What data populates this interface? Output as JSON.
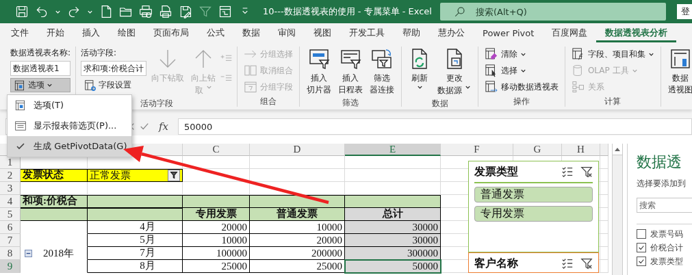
{
  "title_bar": {
    "title": "10---数据透视表的使用 - 专属菜单 - Excel",
    "search": {
      "placeholder": "搜索(Alt+Q)"
    },
    "account_button": "登"
  },
  "ribbon_tabs": [
    {
      "label": "文件",
      "selected": false
    },
    {
      "label": "开始",
      "selected": false
    },
    {
      "label": "插入",
      "selected": false
    },
    {
      "label": "绘图",
      "selected": false
    },
    {
      "label": "页面布局",
      "selected": false
    },
    {
      "label": "公式",
      "selected": false
    },
    {
      "label": "数据",
      "selected": false
    },
    {
      "label": "审阅",
      "selected": false
    },
    {
      "label": "视图",
      "selected": false
    },
    {
      "label": "开发工具",
      "selected": false
    },
    {
      "label": "帮助",
      "selected": false
    },
    {
      "label": "慧办公",
      "selected": false
    },
    {
      "label": "Power Pivot",
      "selected": false
    },
    {
      "label": "百度网盘",
      "selected": false
    },
    {
      "label": "数据透视表分析",
      "selected": true
    }
  ],
  "ribbon": {
    "groups": [
      {
        "columns": [
          {
            "kind": "fields",
            "items": [
              {
                "kind": "caption",
                "text": "数据透视表名称:"
              },
              {
                "kind": "input",
                "value": "数据透视表1"
              },
              {
                "kind": "button",
                "label": "选项",
                "dropdown": true,
                "pressed": true
              }
            ]
          }
        ]
      },
      {
        "label": "活动字段",
        "columns": [
          {
            "kind": "fields",
            "items": [
              {
                "kind": "caption",
                "text": "活动字段:"
              },
              {
                "kind": "input",
                "value": "求和项:价税合计"
              },
              {
                "kind": "button",
                "label": "字段设置",
                "dropdown": false,
                "pressed": false
              }
            ]
          },
          {
            "kind": "large",
            "lines": [
              "向下钻取"
            ],
            "disabled": true,
            "dropdown": false
          },
          {
            "kind": "large",
            "lines": [
              "向上钻",
              "取"
            ],
            "disabled": true,
            "dropdown": true
          },
          {
            "kind": "icons",
            "disabled": true
          }
        ]
      },
      {
        "label": "组合",
        "columns": [
          {
            "kind": "stack",
            "items": [
              {
                "label": "分组选择",
                "disabled": true,
                "dropdown": false
              },
              {
                "label": "取消组合",
                "disabled": true,
                "dropdown": false
              },
              {
                "label": "分组字段",
                "disabled": true,
                "dropdown": false
              }
            ]
          }
        ]
      },
      {
        "label": "筛选",
        "columns": [
          {
            "kind": "large",
            "lines": [
              "插入",
              "切片器"
            ],
            "disabled": false,
            "dropdown": false
          },
          {
            "kind": "large",
            "lines": [
              "插入",
              "日程表"
            ],
            "disabled": false,
            "dropdown": false
          },
          {
            "kind": "large",
            "lines": [
              "筛选",
              "器连接"
            ],
            "disabled": false,
            "dropdown": false
          }
        ]
      },
      {
        "label": "数据",
        "columns": [
          {
            "kind": "large",
            "lines": [
              "刷新"
            ],
            "disabled": false,
            "dropdown": true
          },
          {
            "kind": "large",
            "lines": [
              "更改",
              "数据源"
            ],
            "disabled": false,
            "dropdown": true
          }
        ]
      },
      {
        "label": "操作",
        "columns": [
          {
            "kind": "stack",
            "items": [
              {
                "label": "清除",
                "disabled": false,
                "dropdown": true
              },
              {
                "label": "选择",
                "disabled": false,
                "dropdown": true
              },
              {
                "label": "移动数据透视表",
                "disabled": false,
                "dropdown": false
              }
            ]
          }
        ]
      },
      {
        "label": "计算",
        "columns": [
          {
            "kind": "stack",
            "items": [
              {
                "label": "字段、项目和集",
                "disabled": false,
                "dropdown": true
              },
              {
                "label": "OLAP 工具",
                "disabled": true,
                "dropdown": true
              },
              {
                "label": "关系",
                "disabled": true,
                "dropdown": false
              }
            ]
          }
        ]
      },
      {
        "columns": [
          {
            "kind": "large",
            "lines": [
              "数据",
              "透视图"
            ],
            "disabled": false,
            "dropdown": false
          }
        ]
      }
    ]
  },
  "options_menu": {
    "items": [
      {
        "label": "选项(T)",
        "checked": false,
        "selected": false
      },
      {
        "label": "显示报表筛选页(P)...",
        "checked": false,
        "selected": false
      },
      {
        "label": "生成 GetPivotData(G)",
        "checked": true,
        "selected": true
      }
    ]
  },
  "formula_bar": {
    "insert_function": "fx",
    "value": "50000"
  },
  "sheet": {
    "columns": [
      {
        "label": "C",
        "selected": false
      },
      {
        "label": "D",
        "selected": false
      },
      {
        "label": "E",
        "selected": true
      },
      {
        "label": "F",
        "selected": false
      },
      {
        "label": "G",
        "selected": false
      },
      {
        "label": "H",
        "selected": false
      }
    ],
    "rows": [
      {
        "label": "1",
        "selected": false,
        "cells": [
          {
            "kind": "empty"
          },
          {
            "kind": "empty"
          },
          {
            "kind": "empty"
          },
          {
            "kind": "empty"
          },
          {
            "kind": "empty"
          },
          {
            "kind": "empty"
          },
          {
            "kind": "empty"
          },
          {
            "kind": "empty"
          }
        ]
      },
      {
        "label": "2",
        "selected": false,
        "cells": [
          {
            "kind": "filter-label",
            "text": "发票状态"
          },
          {
            "kind": "filter-value",
            "text": "正常发票"
          },
          {
            "kind": "empty"
          },
          {
            "kind": "empty"
          },
          {
            "kind": "empty"
          },
          {
            "kind": "empty"
          },
          {
            "kind": "empty"
          },
          {
            "kind": "empty"
          }
        ]
      },
      {
        "label": "3",
        "selected": false,
        "cells": [
          {
            "kind": "empty"
          },
          {
            "kind": "empty"
          },
          {
            "kind": "empty"
          },
          {
            "kind": "empty"
          },
          {
            "kind": "empty"
          },
          {
            "kind": "empty"
          },
          {
            "kind": "empty"
          },
          {
            "kind": "empty"
          }
        ]
      },
      {
        "label": "4",
        "selected": false,
        "cells": [
          {
            "kind": "value-label",
            "text": "和项:价税合"
          },
          {
            "kind": "band"
          },
          {
            "kind": "band"
          },
          {
            "kind": "band"
          },
          {
            "kind": "band"
          },
          {
            "kind": "empty"
          },
          {
            "kind": "empty"
          },
          {
            "kind": "empty"
          }
        ]
      },
      {
        "label": "5",
        "selected": false,
        "cells": [
          {
            "kind": "band"
          },
          {
            "kind": "band"
          },
          {
            "kind": "column-label",
            "text": "专用发票"
          },
          {
            "kind": "column-label",
            "text": "普通发票"
          },
          {
            "kind": "total-label",
            "text": "总计"
          },
          {
            "kind": "empty"
          },
          {
            "kind": "empty"
          },
          {
            "kind": "empty"
          }
        ]
      },
      {
        "label": "6",
        "selected": false,
        "cells": [
          {
            "kind": "row-group"
          },
          {
            "kind": "item",
            "text": "4月"
          },
          {
            "kind": "number",
            "text": "20000"
          },
          {
            "kind": "number",
            "text": "10000"
          },
          {
            "kind": "total",
            "text": "30000"
          },
          {
            "kind": "empty"
          },
          {
            "kind": "empty"
          },
          {
            "kind": "empty"
          }
        ]
      },
      {
        "label": "7",
        "selected": false,
        "cells": [
          {
            "kind": "row-group"
          },
          {
            "kind": "item",
            "text": "5月"
          },
          {
            "kind": "number",
            "text": "10000"
          },
          {
            "kind": "number",
            "text": "20000"
          },
          {
            "kind": "total",
            "text": "30000"
          },
          {
            "kind": "empty"
          },
          {
            "kind": "empty"
          },
          {
            "kind": "empty"
          }
        ]
      },
      {
        "label": "8",
        "selected": false,
        "cells": [
          {
            "kind": "year",
            "text": "2018年",
            "expanded": true
          },
          {
            "kind": "item",
            "text": "7月"
          },
          {
            "kind": "number",
            "text": "100000"
          },
          {
            "kind": "number",
            "text": "200000"
          },
          {
            "kind": "total",
            "text": "300000"
          },
          {
            "kind": "empty"
          },
          {
            "kind": "empty"
          },
          {
            "kind": "empty"
          }
        ]
      },
      {
        "label": "9",
        "selected": true,
        "cells": [
          {
            "kind": "row-group"
          },
          {
            "kind": "item",
            "text": "8月"
          },
          {
            "kind": "number",
            "text": "25000"
          },
          {
            "kind": "number",
            "text": "25000"
          },
          {
            "kind": "total",
            "text": "50000"
          },
          {
            "kind": "empty"
          },
          {
            "kind": "empty"
          },
          {
            "kind": "empty"
          }
        ]
      }
    ]
  },
  "slicers": [
    {
      "title": "发票类型",
      "color": "#8cc152",
      "items": [
        {
          "label": "普通发票",
          "selected": true
        },
        {
          "label": "专用发票",
          "selected": true
        }
      ]
    },
    {
      "title": "客户名称",
      "color": "#ed7d31"
    }
  ],
  "field_pane": {
    "title": "数据透",
    "subtitle": "选择要添加到",
    "search": {
      "placeholder": "搜索"
    },
    "fields": [
      {
        "label": "发票号码",
        "checked": false
      },
      {
        "label": "价税合计",
        "checked": true
      },
      {
        "label": "发票类型",
        "checked": true
      }
    ]
  }
}
